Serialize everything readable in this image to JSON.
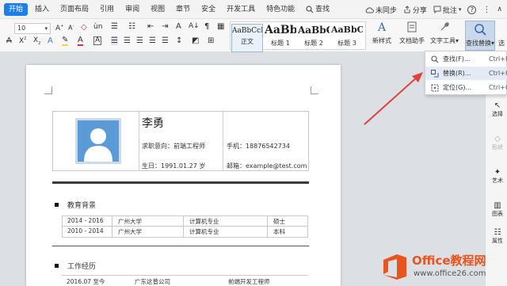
{
  "menubar": {
    "items": [
      "开始",
      "插入",
      "页面布局",
      "引用",
      "审阅",
      "视图",
      "章节",
      "安全",
      "开发工具",
      "特色功能",
      "查找"
    ],
    "right": [
      "未同步",
      "分享",
      "批注"
    ]
  },
  "ribbon": {
    "font_size": "10",
    "styles": [
      {
        "sample": "AaBbCcDd",
        "label": "正文"
      },
      {
        "sample": "AaBb",
        "label": "标题 1"
      },
      {
        "sample": "AaBbC",
        "label": "标题 2"
      },
      {
        "sample": "AaBbC",
        "label": "标题 3"
      }
    ],
    "new_style": "新样式",
    "doc_assistant": "文档助手",
    "text_tools": "文字工具",
    "find_replace": "查找替换",
    "select": "选"
  },
  "dropdown": {
    "items": [
      {
        "label": "查找(F)...",
        "shortcut": "Ctrl+F"
      },
      {
        "label": "替换(R)...",
        "shortcut": "Ctrl+H"
      },
      {
        "label": "定位(G)...",
        "shortcut": "Ctrl+G"
      }
    ]
  },
  "rightpane": {
    "items": [
      "选择",
      "形状",
      "艺术",
      "图表",
      "属性"
    ]
  },
  "resume": {
    "name": "李勇",
    "job_intent": "求职意向：前端工程师",
    "birth": "生日：1991.01.27 岁",
    "phone": "手机：18876542734",
    "email": "邮箱：example@test.com",
    "education_title": "教育背景",
    "education": [
      [
        "2014 - 2016",
        "广州大学",
        "计算机专业",
        "硕士"
      ],
      [
        "2010 - 2014",
        "广州大学",
        "计算机专业",
        "本科"
      ]
    ],
    "work_title": "工作经历",
    "work": [
      [
        "2016.07 至今",
        "广东这普公司",
        "前端开发工程师"
      ]
    ]
  },
  "watermark": {
    "title": "Office教程网",
    "url": "www.office26.com"
  },
  "colors": {
    "accent": "#1f7fe8",
    "avatar": "#5b9bd5",
    "arrow": "#e04040",
    "logo": "#e8531e"
  }
}
